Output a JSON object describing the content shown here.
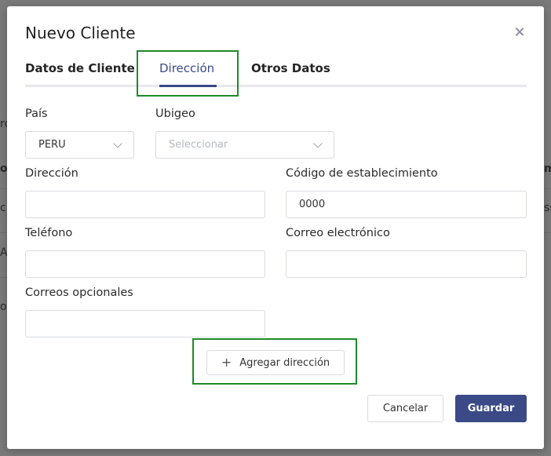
{
  "background": {
    "fragments": [
      "ro",
      "o",
      "cli",
      "A",
      "ote",
      "m",
      "ss"
    ]
  },
  "modal": {
    "title": "Nuevo Cliente",
    "tabs": [
      {
        "label": "Datos de Cliente",
        "active": false
      },
      {
        "label": "Dirección",
        "active": true
      },
      {
        "label": "Otros Datos",
        "active": false
      }
    ],
    "form": {
      "country": {
        "label": "País",
        "value": "PERU"
      },
      "ubigeo": {
        "label": "Ubigeo",
        "placeholder": "Seleccionar"
      },
      "address": {
        "label": "Dirección",
        "value": ""
      },
      "establishment_code": {
        "label": "Código de establecimiento",
        "value": "0000"
      },
      "phone": {
        "label": "Teléfono",
        "value": ""
      },
      "email": {
        "label": "Correo electrónico",
        "value": ""
      },
      "optional_emails": {
        "label": "Correos opcionales",
        "value": ""
      }
    },
    "add_address_label": "Agregar dirección",
    "buttons": {
      "cancel": "Cancelar",
      "save": "Guardar"
    }
  },
  "colors": {
    "primary": "#3b4a86",
    "highlight": "#1f8a2b",
    "overlay": "#7a7a7a"
  }
}
